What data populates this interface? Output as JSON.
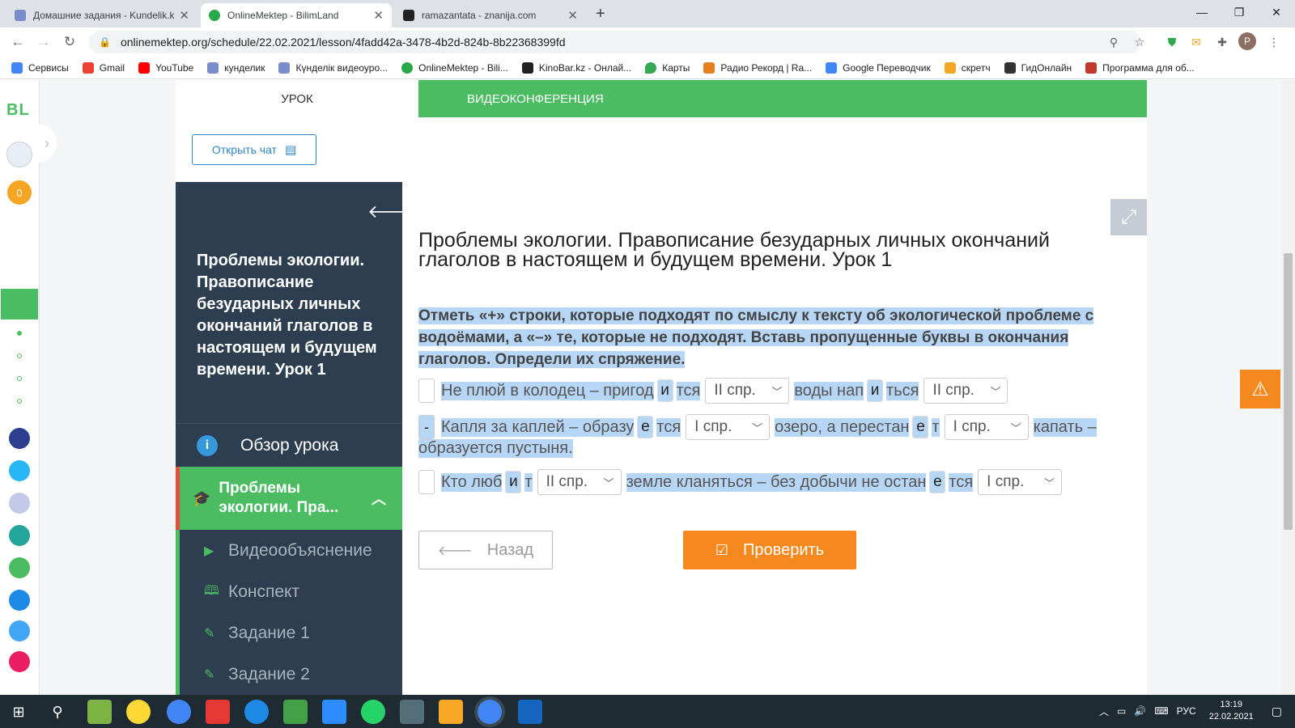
{
  "browser": {
    "tabs": [
      {
        "title": "Домашние задания - Kundelik.k",
        "active": false
      },
      {
        "title": "OnlineMektep - BilimLand",
        "active": true
      },
      {
        "title": "ramazantata - znanija.com",
        "active": false
      }
    ],
    "url": "onlinemektep.org/schedule/22.02.2021/lesson/4fadd42a-3478-4b2d-824b-8b22368399fd",
    "bookmarks": [
      "Сервисы",
      "Gmail",
      "YouTube",
      "кунделик",
      "Күнделік видеоуро...",
      "OnlineMektep - Bili...",
      "KinoBar.kz - Онлай...",
      "Карты",
      "Радио Рекорд | Ra...",
      "Google Переводчик",
      "скретч",
      "ГидОнлайн",
      "Программа для об..."
    ]
  },
  "rail": {
    "logo": "BL",
    "points": "0"
  },
  "lesson_tabs": {
    "lesson": "УРОК",
    "video": "ВИДЕОКОНФЕРЕНЦИЯ"
  },
  "chat_button": "Открыть чат",
  "sidebar": {
    "title": "Проблемы экологии. Правописание безударных личных окончаний глаголов в настоящем и будущем времени. Урок 1",
    "overview": "Обзор урока",
    "active_section": "Проблемы экологии. Пра...",
    "items": [
      "Видеообъяснение",
      "Конспект",
      "Задание 1",
      "Задание 2"
    ]
  },
  "main": {
    "title": "Проблемы экологии. Правописание безударных личных окончаний глаголов в настоящем и будущем времени. Урок 1",
    "instruction": "Отметь «+» строки, которые подходят по смыслу к тексту об экологической проблеме с водоёмами, а «–» те, которые не подходят. Вставь пропущенные буквы в окончания глаголов. Определи их спряжение.",
    "lines": [
      {
        "check": "",
        "t1": "Не плюй в колодец – пригод",
        "i1": "и",
        "t2": "тся",
        "s1": "II спр.",
        "t3": "воды нап",
        "i2": "и",
        "t4": "ться",
        "s2": "II спр."
      },
      {
        "check": "-",
        "t1": "Капля за каплей – образу",
        "i1": "е",
        "t2": "тся",
        "s1": "I спр.",
        "t3": "озеро, а перестан",
        "i2": "е",
        "t4": "т",
        "s2": "I спр.",
        "t5": "капать –",
        "t6": "образуется пустыня."
      },
      {
        "check": "",
        "t1": "Кто люб",
        "i1": "и",
        "t2": "т",
        "s1": "II спр.",
        "t3": "земле кланяться – без добычи не остан",
        "i2": "е",
        "t4": "тся",
        "s2": "I спр."
      }
    ],
    "back_button": "Назад",
    "check_button": "Проверить"
  },
  "taskbar": {
    "lang": "РУС",
    "time": "13:19",
    "date": "22.02.2021"
  },
  "colors": {
    "green": "#4cbc62",
    "navy": "#2d3e50",
    "orange": "#f5891f",
    "highlight": "#b7d6f5"
  }
}
